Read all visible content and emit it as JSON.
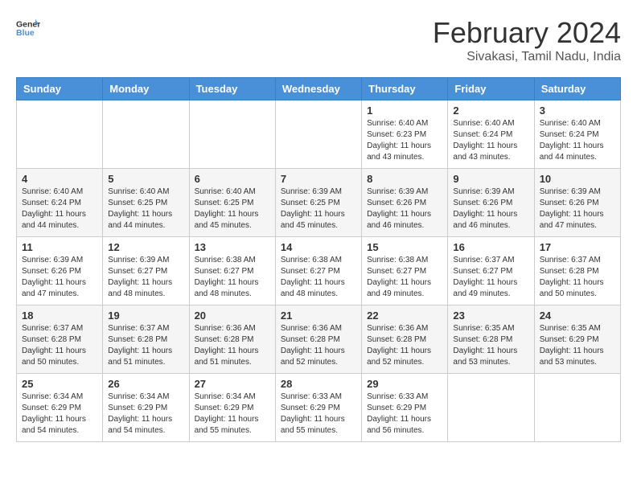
{
  "logo": {
    "general": "General",
    "blue": "Blue"
  },
  "title": "February 2024",
  "subtitle": "Sivakasi, Tamil Nadu, India",
  "headers": [
    "Sunday",
    "Monday",
    "Tuesday",
    "Wednesday",
    "Thursday",
    "Friday",
    "Saturday"
  ],
  "weeks": [
    [
      {
        "day": "",
        "sunrise": "",
        "sunset": "",
        "daylight": ""
      },
      {
        "day": "",
        "sunrise": "",
        "sunset": "",
        "daylight": ""
      },
      {
        "day": "",
        "sunrise": "",
        "sunset": "",
        "daylight": ""
      },
      {
        "day": "",
        "sunrise": "",
        "sunset": "",
        "daylight": ""
      },
      {
        "day": "1",
        "sunrise": "Sunrise: 6:40 AM",
        "sunset": "Sunset: 6:23 PM",
        "daylight": "Daylight: 11 hours and 43 minutes."
      },
      {
        "day": "2",
        "sunrise": "Sunrise: 6:40 AM",
        "sunset": "Sunset: 6:24 PM",
        "daylight": "Daylight: 11 hours and 43 minutes."
      },
      {
        "day": "3",
        "sunrise": "Sunrise: 6:40 AM",
        "sunset": "Sunset: 6:24 PM",
        "daylight": "Daylight: 11 hours and 44 minutes."
      }
    ],
    [
      {
        "day": "4",
        "sunrise": "Sunrise: 6:40 AM",
        "sunset": "Sunset: 6:24 PM",
        "daylight": "Daylight: 11 hours and 44 minutes."
      },
      {
        "day": "5",
        "sunrise": "Sunrise: 6:40 AM",
        "sunset": "Sunset: 6:25 PM",
        "daylight": "Daylight: 11 hours and 44 minutes."
      },
      {
        "day": "6",
        "sunrise": "Sunrise: 6:40 AM",
        "sunset": "Sunset: 6:25 PM",
        "daylight": "Daylight: 11 hours and 45 minutes."
      },
      {
        "day": "7",
        "sunrise": "Sunrise: 6:39 AM",
        "sunset": "Sunset: 6:25 PM",
        "daylight": "Daylight: 11 hours and 45 minutes."
      },
      {
        "day": "8",
        "sunrise": "Sunrise: 6:39 AM",
        "sunset": "Sunset: 6:26 PM",
        "daylight": "Daylight: 11 hours and 46 minutes."
      },
      {
        "day": "9",
        "sunrise": "Sunrise: 6:39 AM",
        "sunset": "Sunset: 6:26 PM",
        "daylight": "Daylight: 11 hours and 46 minutes."
      },
      {
        "day": "10",
        "sunrise": "Sunrise: 6:39 AM",
        "sunset": "Sunset: 6:26 PM",
        "daylight": "Daylight: 11 hours and 47 minutes."
      }
    ],
    [
      {
        "day": "11",
        "sunrise": "Sunrise: 6:39 AM",
        "sunset": "Sunset: 6:26 PM",
        "daylight": "Daylight: 11 hours and 47 minutes."
      },
      {
        "day": "12",
        "sunrise": "Sunrise: 6:39 AM",
        "sunset": "Sunset: 6:27 PM",
        "daylight": "Daylight: 11 hours and 48 minutes."
      },
      {
        "day": "13",
        "sunrise": "Sunrise: 6:38 AM",
        "sunset": "Sunset: 6:27 PM",
        "daylight": "Daylight: 11 hours and 48 minutes."
      },
      {
        "day": "14",
        "sunrise": "Sunrise: 6:38 AM",
        "sunset": "Sunset: 6:27 PM",
        "daylight": "Daylight: 11 hours and 48 minutes."
      },
      {
        "day": "15",
        "sunrise": "Sunrise: 6:38 AM",
        "sunset": "Sunset: 6:27 PM",
        "daylight": "Daylight: 11 hours and 49 minutes."
      },
      {
        "day": "16",
        "sunrise": "Sunrise: 6:37 AM",
        "sunset": "Sunset: 6:27 PM",
        "daylight": "Daylight: 11 hours and 49 minutes."
      },
      {
        "day": "17",
        "sunrise": "Sunrise: 6:37 AM",
        "sunset": "Sunset: 6:28 PM",
        "daylight": "Daylight: 11 hours and 50 minutes."
      }
    ],
    [
      {
        "day": "18",
        "sunrise": "Sunrise: 6:37 AM",
        "sunset": "Sunset: 6:28 PM",
        "daylight": "Daylight: 11 hours and 50 minutes."
      },
      {
        "day": "19",
        "sunrise": "Sunrise: 6:37 AM",
        "sunset": "Sunset: 6:28 PM",
        "daylight": "Daylight: 11 hours and 51 minutes."
      },
      {
        "day": "20",
        "sunrise": "Sunrise: 6:36 AM",
        "sunset": "Sunset: 6:28 PM",
        "daylight": "Daylight: 11 hours and 51 minutes."
      },
      {
        "day": "21",
        "sunrise": "Sunrise: 6:36 AM",
        "sunset": "Sunset: 6:28 PM",
        "daylight": "Daylight: 11 hours and 52 minutes."
      },
      {
        "day": "22",
        "sunrise": "Sunrise: 6:36 AM",
        "sunset": "Sunset: 6:28 PM",
        "daylight": "Daylight: 11 hours and 52 minutes."
      },
      {
        "day": "23",
        "sunrise": "Sunrise: 6:35 AM",
        "sunset": "Sunset: 6:28 PM",
        "daylight": "Daylight: 11 hours and 53 minutes."
      },
      {
        "day": "24",
        "sunrise": "Sunrise: 6:35 AM",
        "sunset": "Sunset: 6:29 PM",
        "daylight": "Daylight: 11 hours and 53 minutes."
      }
    ],
    [
      {
        "day": "25",
        "sunrise": "Sunrise: 6:34 AM",
        "sunset": "Sunset: 6:29 PM",
        "daylight": "Daylight: 11 hours and 54 minutes."
      },
      {
        "day": "26",
        "sunrise": "Sunrise: 6:34 AM",
        "sunset": "Sunset: 6:29 PM",
        "daylight": "Daylight: 11 hours and 54 minutes."
      },
      {
        "day": "27",
        "sunrise": "Sunrise: 6:34 AM",
        "sunset": "Sunset: 6:29 PM",
        "daylight": "Daylight: 11 hours and 55 minutes."
      },
      {
        "day": "28",
        "sunrise": "Sunrise: 6:33 AM",
        "sunset": "Sunset: 6:29 PM",
        "daylight": "Daylight: 11 hours and 55 minutes."
      },
      {
        "day": "29",
        "sunrise": "Sunrise: 6:33 AM",
        "sunset": "Sunset: 6:29 PM",
        "daylight": "Daylight: 11 hours and 56 minutes."
      },
      {
        "day": "",
        "sunrise": "",
        "sunset": "",
        "daylight": ""
      },
      {
        "day": "",
        "sunrise": "",
        "sunset": "",
        "daylight": ""
      }
    ]
  ]
}
